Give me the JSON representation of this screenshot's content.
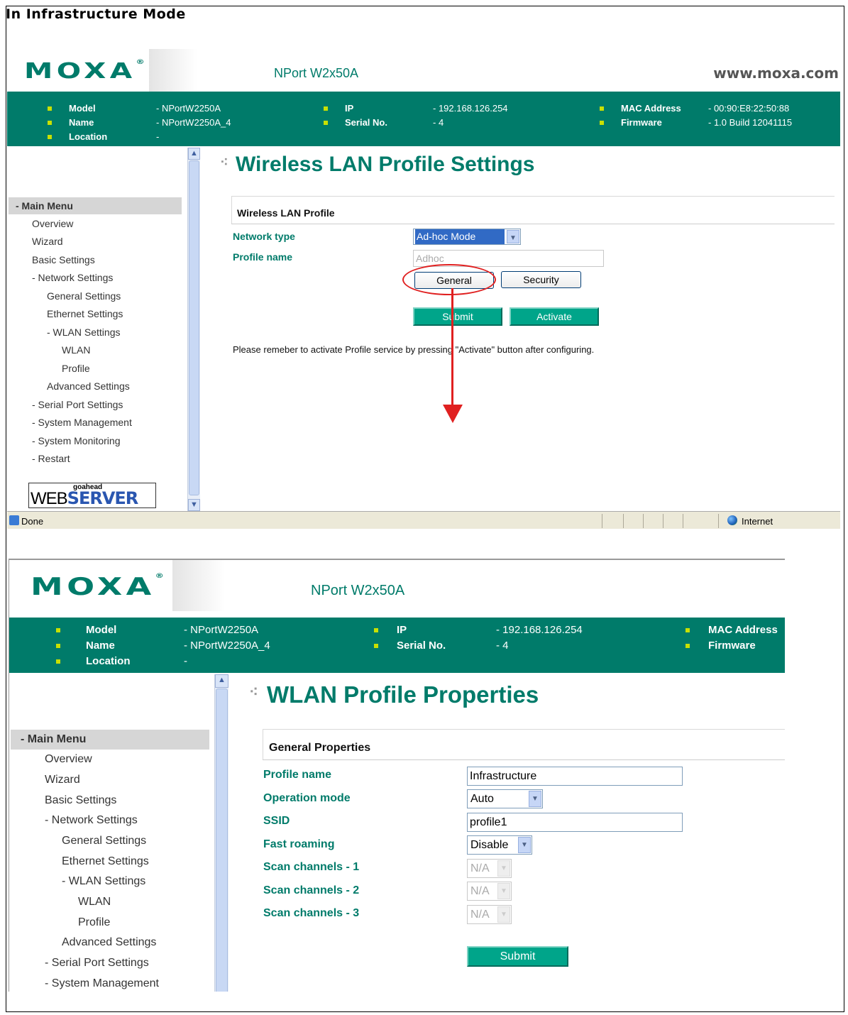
{
  "heading": "In Infrastructure Mode",
  "brand": {
    "logo": "MOXA",
    "registered": "®",
    "product": "NPort W2x50A",
    "site": "www.moxa.com"
  },
  "info": {
    "model_label": "Model",
    "model_value": "- NPortW2250A",
    "name_label": "Name",
    "name_value": "- NPortW2250A_4",
    "location_label": "Location",
    "location_value": "-",
    "ip_label": "IP",
    "ip_value": "- 192.168.126.254",
    "serial_label": "Serial No.",
    "serial_value": "- 4",
    "mac_label": "MAC Address",
    "mac_value": "- 00:90:E8:22:50:88",
    "firmware_label": "Firmware",
    "firmware_value": "- 1.0 Build 12041115"
  },
  "menu": {
    "head": "- Main Menu",
    "items": [
      "Overview",
      "Wizard",
      "Basic Settings",
      "- Network Settings",
      "General Settings",
      "Ethernet Settings",
      "- WLAN Settings",
      "WLAN",
      "Profile",
      "Advanced Settings",
      "- Serial Port Settings",
      "- System Management",
      "- System Monitoring",
      "- Restart"
    ]
  },
  "webserver": {
    "top": "goahead",
    "left": "WEB",
    "right": "SERVER"
  },
  "shot1": {
    "title": "Wireless LAN Profile Settings",
    "section": "Wireless LAN Profile",
    "network_type_label": "Network type",
    "network_type_value": "Ad-hoc Mode",
    "profile_name_label": "Profile name",
    "profile_name_value": "Adhoc",
    "general_btn": "General",
    "security_btn": "Security",
    "submit_btn": "Submit",
    "activate_btn": "Activate",
    "note": "Please remeber to activate Profile service by pressing \"Activate\" button after configuring."
  },
  "status": {
    "left": "Done",
    "right": "Internet"
  },
  "shot2": {
    "title": "WLAN Profile Properties",
    "section": "General Properties",
    "profile_name_label": "Profile name",
    "profile_name_value": "Infrastructure",
    "operation_mode_label": "Operation mode",
    "operation_mode_value": "Auto",
    "ssid_label": "SSID",
    "ssid_value": "profile1",
    "fast_roaming_label": "Fast roaming",
    "fast_roaming_value": "Disable",
    "scan1_label": "Scan channels - 1",
    "scan2_label": "Scan channels - 2",
    "scan3_label": "Scan channels - 3",
    "scan_value": "N/A",
    "submit_btn": "Submit"
  },
  "colors": {
    "brand_green": "#007b6a",
    "bullet": "#c8e000",
    "button_green": "#00a58a",
    "annotation_red": "#e02020"
  },
  "icons": [
    "ie-page-icon",
    "globe-icon",
    "scroll-up-icon",
    "scroll-down-icon",
    "chevron-down-icon"
  ]
}
